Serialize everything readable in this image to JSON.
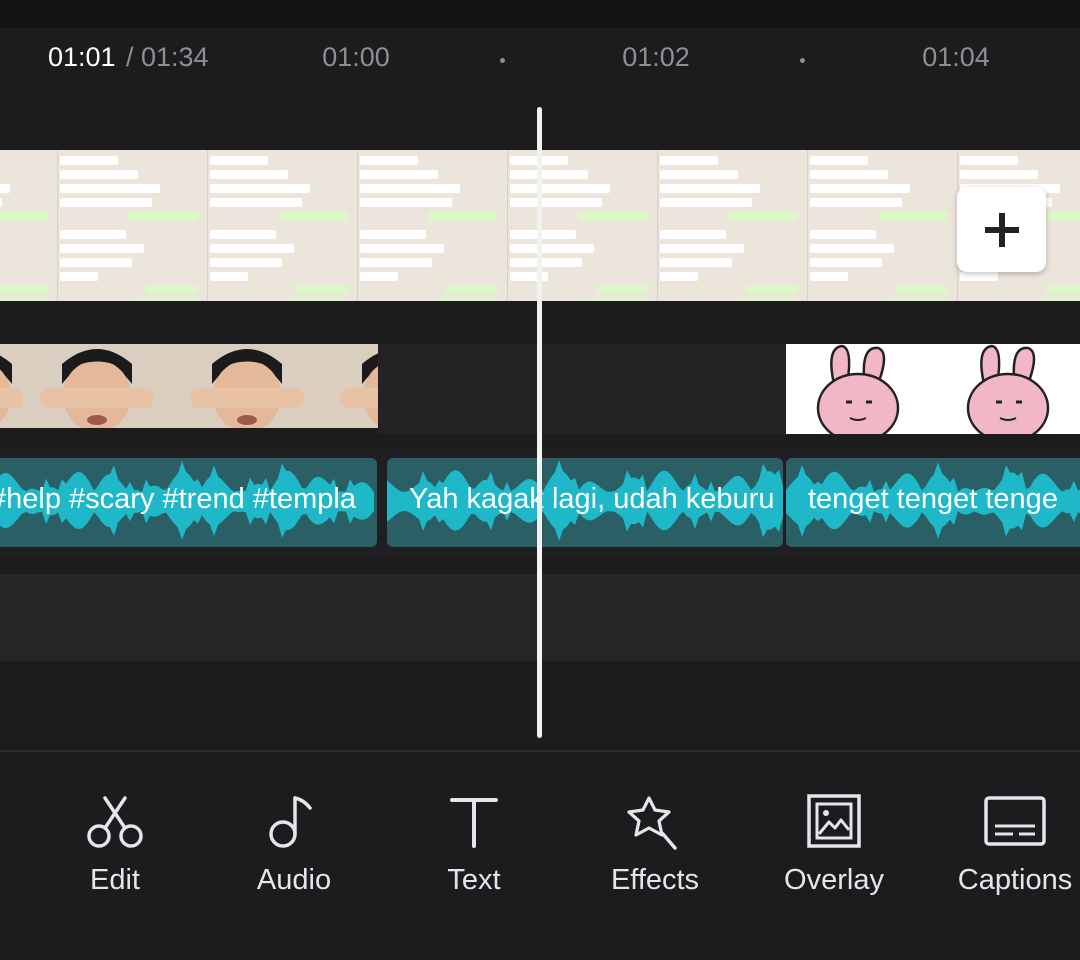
{
  "timeline": {
    "current_time": "01:01",
    "total_time": "/ 01:34",
    "ruler_ticks": [
      "01:00",
      "01:02",
      "01:04"
    ]
  },
  "main_track": {
    "add_button_symbol": "+",
    "thumbnail_content": "chat-screenshot"
  },
  "overlay_track": {
    "clips": [
      {
        "content": "face-covering-eyes"
      },
      {
        "content": "pink-bunny-sticker"
      }
    ]
  },
  "audio_track": {
    "clips": [
      {
        "label": "#help #scary #trend #templa"
      },
      {
        "label": "Yah kagak lagi, udah keburu"
      },
      {
        "label": "tenget tenget tenge"
      }
    ],
    "color": "#1fb8c8"
  },
  "toolbar": {
    "items": [
      {
        "label": "Edit",
        "icon": "scissors-icon"
      },
      {
        "label": "Audio",
        "icon": "music-note-icon"
      },
      {
        "label": "Text",
        "icon": "text-t-icon"
      },
      {
        "label": "Effects",
        "icon": "star-wand-icon"
      },
      {
        "label": "Overlay",
        "icon": "overlay-image-icon"
      },
      {
        "label": "Captions",
        "icon": "captions-icon"
      }
    ]
  }
}
